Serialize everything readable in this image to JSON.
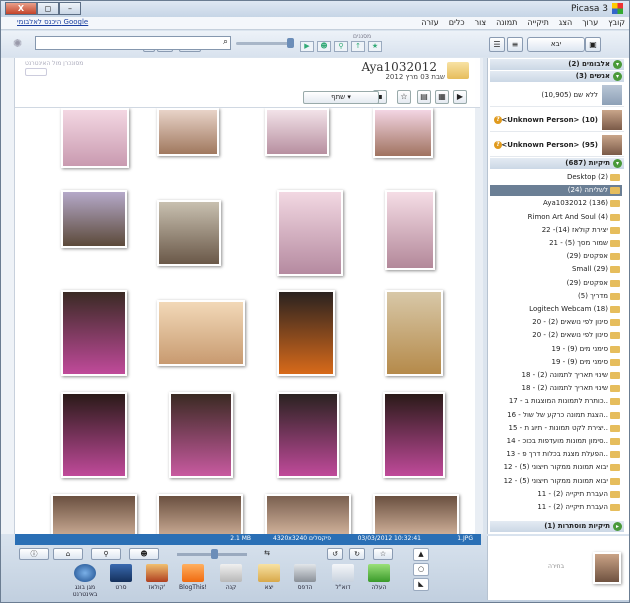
{
  "window": {
    "title": "Picasa 3",
    "buttons": {
      "close": "X",
      "maximize": "◻",
      "minimize": "–"
    }
  },
  "menu": {
    "items": [
      "קובץ",
      "ערוך",
      "הצג",
      "תיקייה",
      "תמונה",
      "צור",
      "כלים",
      "עזרה"
    ],
    "google_link": "היכנס לאלבומי Google"
  },
  "toolbar": {
    "import_label": "יבא",
    "search_placeholder": "",
    "filters_label": "מסננים"
  },
  "album": {
    "title": "Aya1032012",
    "date": "שבת 03 מרץ 2012",
    "share_label": "שתף",
    "web_sync_label": "מסונכרן מול האינטרנט"
  },
  "sidebar": {
    "albums_header": "אלבומים (2)",
    "people_header": "אנשים (3)",
    "people": [
      {
        "label": "ללא שם (10,905)"
      },
      {
        "label": "<Unknown Person> (10)"
      },
      {
        "label": "<Unknown Person> (95)"
      }
    ],
    "folders_header": "תיקיות (687)",
    "folders": [
      "Desktop (2)",
      "לשליחה (24)",
      "Aya1032012 (136)",
      "Rimon Art And Soul (4)",
      "22 -יצירת קולאז (14)",
      "21 - שמור מסך (5)",
      "אפקטים (29)",
      "Small (29)",
      "אפקטים (29)",
      "מדריך (5)",
      "Logitech Webcam (18)",
      "20 - סינון לפי נושאים (2)",
      "20 - סינון לפי נושאים (2)",
      "19 - סימני מים (9)",
      "19 - סימני מים (9)",
      "18 - שינוי תאריך לתמונה (2)",
      "18 - שינוי תאריך לתמונה (2)",
      "17 - כותרת לתמונות המוצגות ב..",
      "16 - הצגת תמונה כרקע של שול..",
      "15 - יצירת לקט תמונות - תיוג ת..",
      "14 - סימון תמונות מועדפות בכוכ..",
      "13 - הפעלת מצגת בכלות דרך פ..",
      "12 - יבוא תמונות ממקור חיצוני (5)",
      "12 - יבוא תמונות ממקור חיצוני (5)",
      "11 - העברת תיקייה (2)",
      "11 - העברת תיקייה (2)"
    ],
    "hidden_header": "תיקיות מוסתרות (1)"
  },
  "status": {
    "filename": "1.JPG",
    "datetime": "03/03/2012 10:32:41",
    "dimensions": "4320x3240 פיקסלים",
    "size": "2.1 MB"
  },
  "tray": {
    "label": "בחירה"
  },
  "actions": [
    "העלה",
    "דוא\"ל",
    "הדפס",
    "יצא",
    "קנה",
    "BlogThis!",
    "קולאז'",
    "סרט",
    "מגן בונג באינטרנט"
  ]
}
